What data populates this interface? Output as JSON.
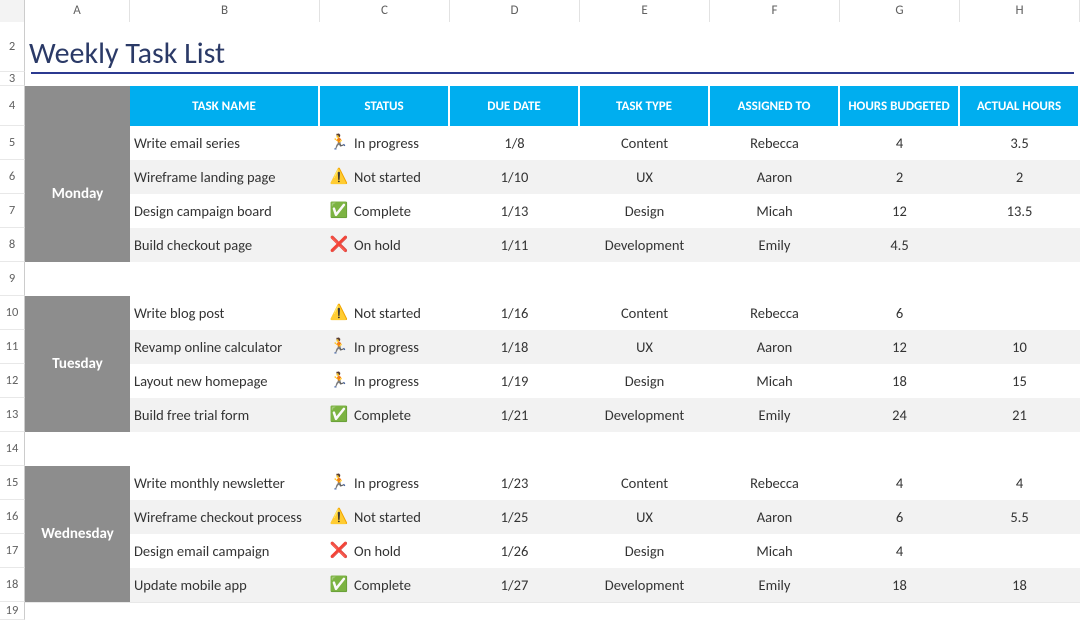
{
  "columns_letters": [
    "",
    "A",
    "B",
    "C",
    "D",
    "E",
    "F",
    "G",
    "H"
  ],
  "row_numbers": [
    "2",
    "3",
    "4",
    "5",
    "6",
    "7",
    "8",
    "9",
    "10",
    "11",
    "12",
    "13",
    "14",
    "15",
    "16",
    "17",
    "18",
    "19"
  ],
  "title": "Weekly Task List",
  "headers": {
    "day": "",
    "task_name": "TASK NAME",
    "status": "STATUS",
    "due_date": "DUE DATE",
    "task_type": "TASK TYPE",
    "assigned_to": "ASSIGNED TO",
    "hours_budgeted": "HOURS BUDGETED",
    "actual_hours": "ACTUAL HOURS"
  },
  "status_labels": {
    "in_progress": "In progress",
    "not_started": "Not started",
    "complete": "Complete",
    "on_hold": "On hold"
  },
  "status_icons": {
    "in_progress": "🏃",
    "not_started": "⚠️",
    "complete": "✅",
    "on_hold": "❌"
  },
  "days": [
    {
      "label": "Monday",
      "tasks": [
        {
          "name": "Write email series",
          "status": "in_progress",
          "due": "1/8",
          "type": "Content",
          "assigned": "Rebecca",
          "budget": "4",
          "actual": "3.5"
        },
        {
          "name": "Wireframe landing page",
          "status": "not_started",
          "due": "1/10",
          "type": "UX",
          "assigned": "Aaron",
          "budget": "2",
          "actual": "2"
        },
        {
          "name": "Design campaign board",
          "status": "complete",
          "due": "1/13",
          "type": "Design",
          "assigned": "Micah",
          "budget": "12",
          "actual": "13.5"
        },
        {
          "name": "Build checkout page",
          "status": "on_hold",
          "due": "1/11",
          "type": "Development",
          "assigned": "Emily",
          "budget": "4.5",
          "actual": ""
        }
      ]
    },
    {
      "label": "Tuesday",
      "tasks": [
        {
          "name": "Write blog post",
          "status": "not_started",
          "due": "1/16",
          "type": "Content",
          "assigned": "Rebecca",
          "budget": "6",
          "actual": ""
        },
        {
          "name": "Revamp online calculator",
          "status": "in_progress",
          "due": "1/18",
          "type": "UX",
          "assigned": "Aaron",
          "budget": "12",
          "actual": "10"
        },
        {
          "name": "Layout new homepage",
          "status": "in_progress",
          "due": "1/19",
          "type": "Design",
          "assigned": "Micah",
          "budget": "18",
          "actual": "15"
        },
        {
          "name": "Build free trial form",
          "status": "complete",
          "due": "1/21",
          "type": "Development",
          "assigned": "Emily",
          "budget": "24",
          "actual": "21"
        }
      ]
    },
    {
      "label": "Wednesday",
      "tasks": [
        {
          "name": "Write monthly newsletter",
          "status": "in_progress",
          "due": "1/23",
          "type": "Content",
          "assigned": "Rebecca",
          "budget": "4",
          "actual": "4"
        },
        {
          "name": "Wireframe checkout process",
          "status": "not_started",
          "due": "1/25",
          "type": "UX",
          "assigned": "Aaron",
          "budget": "6",
          "actual": "5.5"
        },
        {
          "name": "Design email campaign",
          "status": "on_hold",
          "due": "1/26",
          "type": "Design",
          "assigned": "Micah",
          "budget": "4",
          "actual": ""
        },
        {
          "name": "Update mobile app",
          "status": "complete",
          "due": "1/27",
          "type": "Development",
          "assigned": "Emily",
          "budget": "18",
          "actual": "18"
        }
      ]
    }
  ]
}
